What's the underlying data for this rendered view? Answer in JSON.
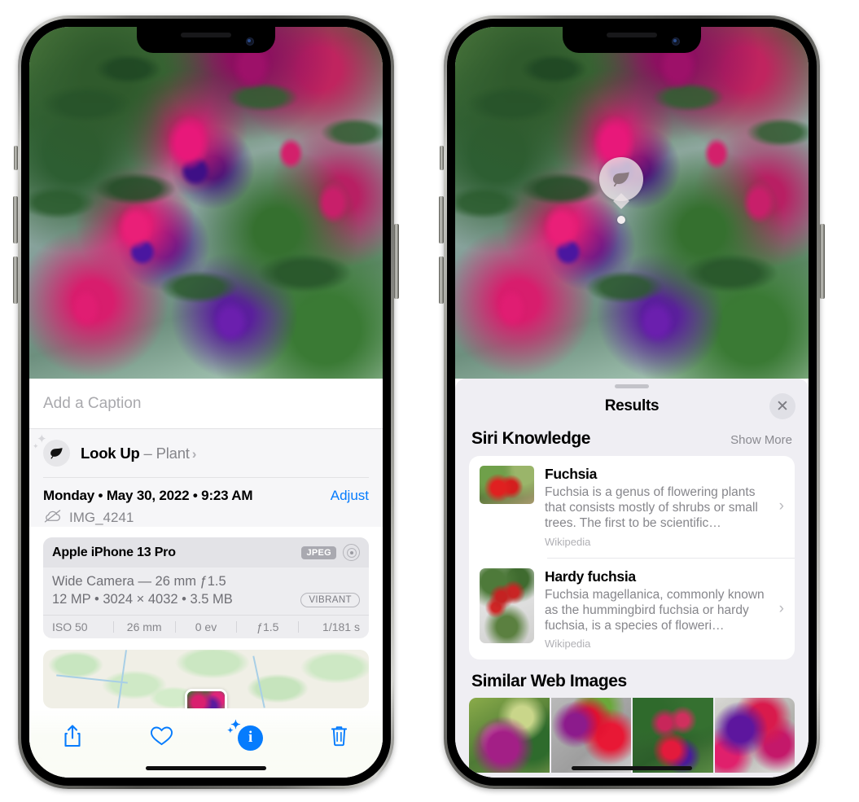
{
  "left_phone": {
    "photo": {
      "alt_name": "fuchsia-flowers-photo"
    },
    "caption": {
      "placeholder": "Add a Caption",
      "value": ""
    },
    "look_up": {
      "icon": "leaf-icon",
      "label": "Look Up",
      "dash": " – ",
      "subject": "Plant",
      "chevron": "›"
    },
    "meta": {
      "date_line": "Monday • May 30, 2022 • 9:23 AM",
      "adjust_label": "Adjust",
      "cloud_icon": "cloud-slash-icon",
      "filename": "IMG_4241"
    },
    "camera_card": {
      "device": "Apple iPhone 13 Pro",
      "format_badge": "JPEG",
      "aperture_icon": "aperture-icon",
      "lens_line": "Wide Camera — 26 mm ƒ1.5",
      "spec_line": "12 MP • 3024 × 4032 • 3.5 MB",
      "style_badge": "VIBRANT",
      "exif": [
        "ISO 50",
        "26 mm",
        "0 ev",
        "ƒ1.5",
        "1/181 s"
      ]
    },
    "map": {
      "name": "photo-location-map",
      "pin": "photo-thumbnail-pin"
    },
    "toolbar": [
      {
        "name": "share-button",
        "icon": "share-icon"
      },
      {
        "name": "favorite-button",
        "icon": "heart-icon"
      },
      {
        "name": "info-button",
        "icon": "info-sparkle-icon",
        "glyph": "i"
      },
      {
        "name": "delete-button",
        "icon": "trash-icon"
      }
    ]
  },
  "right_phone": {
    "photo": {
      "alt_name": "fuchsia-flowers-photo"
    },
    "lookup_badge": {
      "icon": "leaf-icon"
    },
    "sheet": {
      "grabber": "sheet-grabber",
      "title": "Results",
      "close_label": "✕"
    },
    "siri_knowledge": {
      "section_title": "Siri Knowledge",
      "show_more": "Show More",
      "items": [
        {
          "title": "Fuchsia",
          "description": "Fuchsia is a genus of flowering plants that consists mostly of shrubs or small trees. The first to be scientific…",
          "source": "Wikipedia",
          "chevron": "›"
        },
        {
          "title": "Hardy fuchsia",
          "description": "Fuchsia magellanica, commonly known as the hummingbird fuchsia or hardy fuchsia, is a species of floweri…",
          "source": "Wikipedia",
          "chevron": "›"
        }
      ]
    },
    "similar_web_images": {
      "section_title": "Similar Web Images",
      "thumbnails": [
        "fuchsia-web-image-1",
        "fuchsia-web-image-2",
        "fuchsia-web-image-3",
        "fuchsia-web-image-4"
      ]
    }
  },
  "colors": {
    "accent_blue": "#067cfd",
    "sheet_background": "#efeef3",
    "card_background": "#ffffff",
    "secondary_text": "#86868b"
  }
}
